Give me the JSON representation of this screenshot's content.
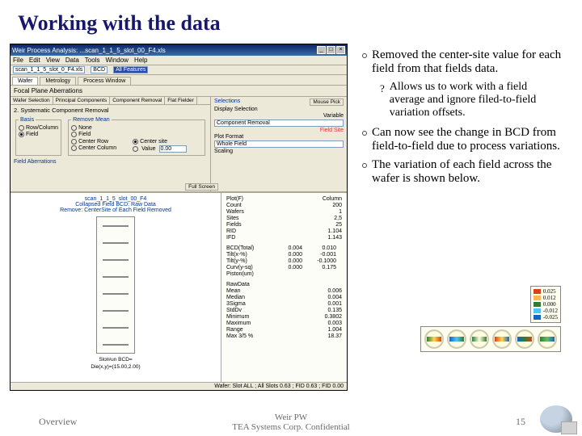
{
  "slide": {
    "title": "Working with the data",
    "footer_left": "Overview",
    "footer_mid_top": "Weir PW",
    "footer_mid_bot": "TEA Systems Corp. Confidential",
    "page": "15"
  },
  "bullets": {
    "b1": "Removed the center-site value for each field from that fields data.",
    "b1a": "Allows us to work with a field average and ignore filed-to-field variation offsets.",
    "b2": "Can now see the change in BCD from field-to-field due to process variations.",
    "b3": "The variation of each field across the wafer is shown below."
  },
  "app": {
    "title": "Weir Process Analysis: ...scan_1_1_5_slot_00_F4.xls",
    "menus": [
      "File",
      "Edit",
      "View",
      "Data",
      "Tools",
      "Window",
      "Help"
    ],
    "toolbar_field": "scan_1_1_5_slot_0_F4.xls",
    "toolbar_mode": "BCD",
    "toolbar_feat": "All Features",
    "tabs": [
      "Wafer",
      "Metrology",
      "Process Window"
    ],
    "panel": "Focal Plane Aberrations",
    "subtabs": [
      "Wafer Selection",
      "Principal Components",
      "Component Removal",
      "Flat Fielder"
    ],
    "section": "2. Systematic Component Removal",
    "basis_legend": "Basis",
    "basis_opts": [
      "Row/Column",
      "Field"
    ],
    "remove_legend": "Remove Mean",
    "remove_opts": [
      "None",
      "Field",
      "Center Row",
      "Center Column",
      "Center site",
      "Value"
    ],
    "value_input": "0.00",
    "color_legend": "Field Aberrations",
    "ur": {
      "selections": "Selections",
      "mouse": "Mouse Pick",
      "display": "Display Selection",
      "comp": "Component Removal",
      "field_site": "Field Site",
      "variable": "Variable",
      "plot": "Plot Format",
      "whole": "Whole Field",
      "scaling": "Scaling"
    },
    "chart": {
      "full": "Full Screen",
      "t1": "scan_1_1_5_slot_00_F4",
      "t2": "Collapsed Field BCD: Raw Data",
      "t3": "Remove: CenterSite of Each Field Removed",
      "foot1": "Slot#un BCD=",
      "foot2": "Die(x,y)=(15.00,2.00)"
    },
    "stats": {
      "h1": "Plot(F)",
      "h2": "Column",
      "rows1": [
        [
          "Count",
          "200"
        ],
        [
          "Wafers",
          "1"
        ],
        [
          "Sites",
          "2,5"
        ],
        [
          "Fields",
          "25"
        ],
        [
          "RID",
          "1.104"
        ],
        [
          "IFD",
          "1.143"
        ]
      ],
      "rows3": [
        [
          "BCD(Total)",
          "0.004",
          "0.010"
        ],
        [
          "Tilt(x-%)",
          "0.000",
          "-0.001"
        ],
        [
          "Tilt(y-%)",
          "0.000",
          "-0.1000"
        ],
        [
          "Curv(y-sq)",
          "0.000",
          "0.175"
        ],
        [
          "Piston(um)",
          "",
          ""
        ]
      ],
      "rawh": "RawData",
      "raw": [
        [
          "Mean",
          "0.006"
        ],
        [
          "Median",
          "0.004"
        ],
        [
          "3Sigma",
          "0.001"
        ],
        [
          "StdDv",
          "0.135"
        ],
        [
          "Minimum",
          "0.3802"
        ],
        [
          "Maximum",
          "0.003"
        ],
        [
          "Range",
          "1.004"
        ],
        [
          "Max 3/5 %",
          "18.37"
        ]
      ]
    },
    "status": "Wafer: Slot ALL ; All Slots 0.63 ; FID 0.63 ; FID 0.00"
  },
  "legend_vals": [
    "0.025",
    "0.012",
    "0.000",
    "-0.012",
    "-0.025"
  ],
  "legend_colors": [
    "#d84315",
    "#ffb74d",
    "#2e7d32",
    "#4fc3f7",
    "#1565c0"
  ]
}
